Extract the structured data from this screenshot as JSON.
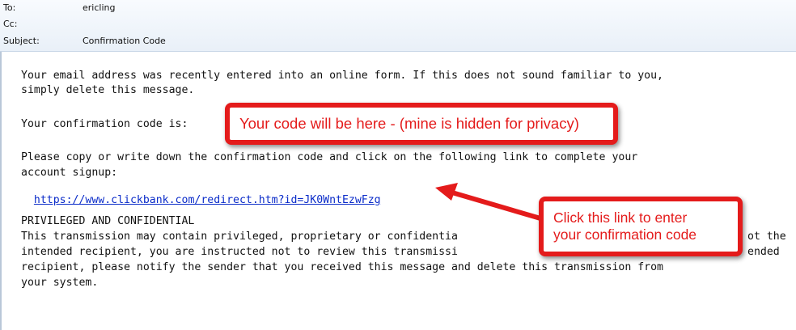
{
  "header": {
    "to_label": "To:",
    "to_value": "ericling",
    "cc_label": "Cc:",
    "cc_value": "",
    "subject_label": "Subject:",
    "subject_value": "Confirmation Code"
  },
  "email": {
    "p1_l1": "Your email address was recently entered into an online form. If this does not sound familiar to you,",
    "p1_l2": "simply delete this message.",
    "code_label": "Your confirmation code is:",
    "p2_l1": "Please copy or write down the confirmation code and click on the following link to complete your",
    "p2_l2": "account signup:",
    "link": "https://www.clickbank.com/redirect.htm?id=JK0WntEzwFzg",
    "legal_title": "PRIVILEGED AND CONFIDENTIAL",
    "legal_l1_a": "This transmission may contain privileged, proprietary or confidentia",
    "legal_l1_b": "ot the",
    "legal_l2_a": "intended recipient, you are instructed not to review this transmissi",
    "legal_l2_b": "ended",
    "legal_l3": "recipient, please notify the sender that you received this message and delete this transmission from",
    "legal_l4": "your system."
  },
  "callouts": {
    "code_note": "Your code will be here - (mine is hidden for privacy)",
    "link_note_l1": "Click this link to enter",
    "link_note_l2": "your confirmation code"
  },
  "colors": {
    "annotation": "#e41b1b",
    "link": "#0b2cc9"
  }
}
